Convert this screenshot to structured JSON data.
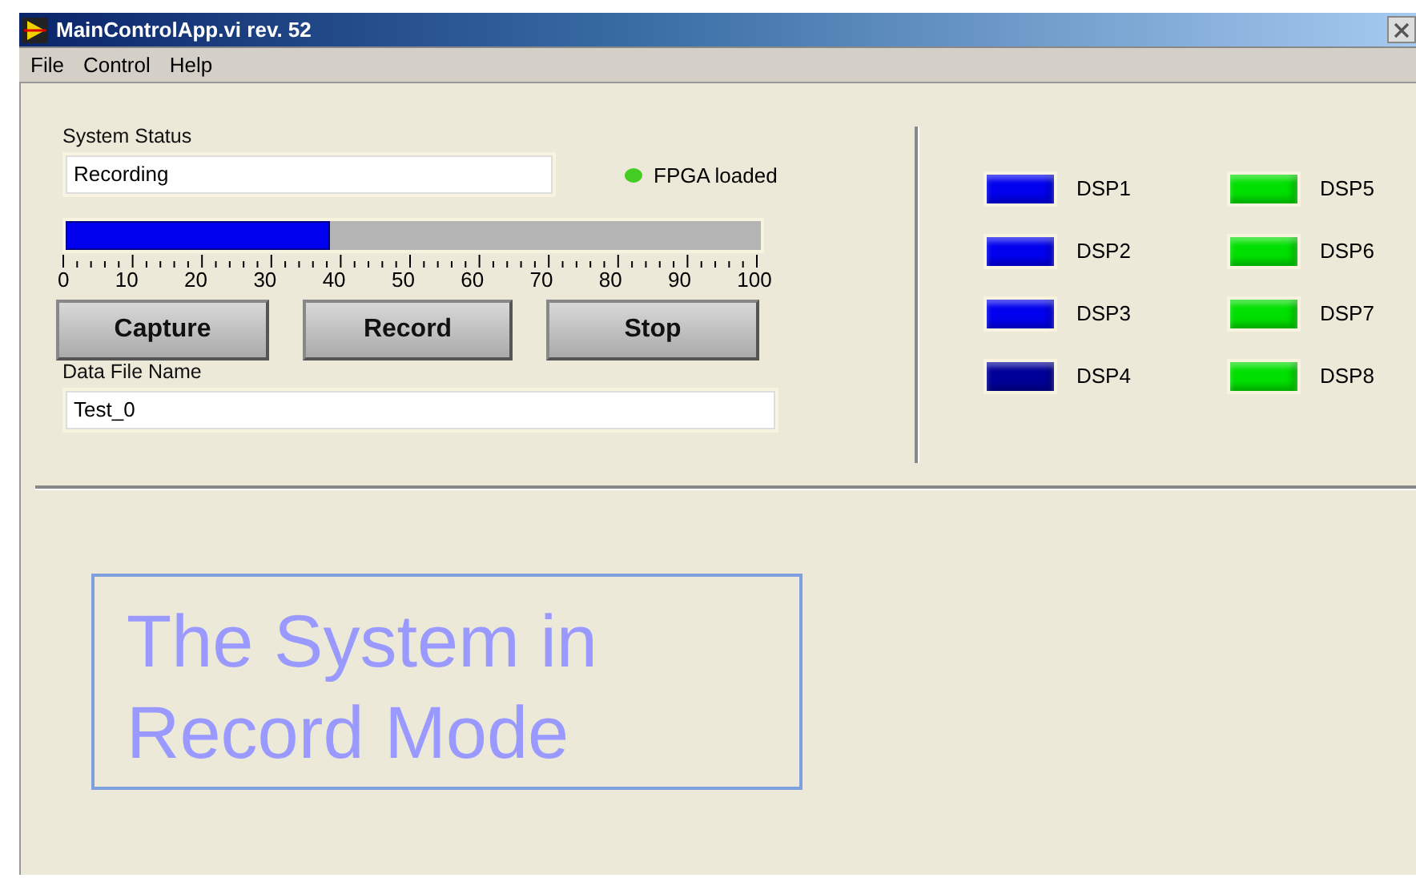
{
  "window": {
    "title": "MainControlApp.vi rev. 52"
  },
  "menu": [
    "File",
    "Control",
    "Help"
  ],
  "system_status": {
    "label": "System Status",
    "value": "Recording"
  },
  "fpga": {
    "label": "FPGA loaded",
    "color": "#44cc22"
  },
  "progress": {
    "level": 0.38,
    "scale": [
      "0",
      "10",
      "20",
      "30",
      "40",
      "50",
      "60",
      "70",
      "80",
      "90",
      "100"
    ]
  },
  "buttons": [
    "Capture",
    "Record",
    "Stop"
  ],
  "data_file": {
    "label": "Data File Name",
    "value": "Test_0"
  },
  "dsp": [
    {
      "label": "DSP1",
      "color": "#0000ee"
    },
    {
      "label": "DSP2",
      "color": "#0000ee"
    },
    {
      "label": "DSP3",
      "color": "#0000ee"
    },
    {
      "label": "DSP4",
      "color": "#000099"
    },
    {
      "label": "DSP5",
      "color": "#00e000"
    },
    {
      "label": "DSP6",
      "color": "#00e000"
    },
    {
      "label": "DSP7",
      "color": "#00e000"
    },
    {
      "label": "DSP8",
      "color": "#00e000"
    }
  ],
  "caption": "The System in Record Mode"
}
